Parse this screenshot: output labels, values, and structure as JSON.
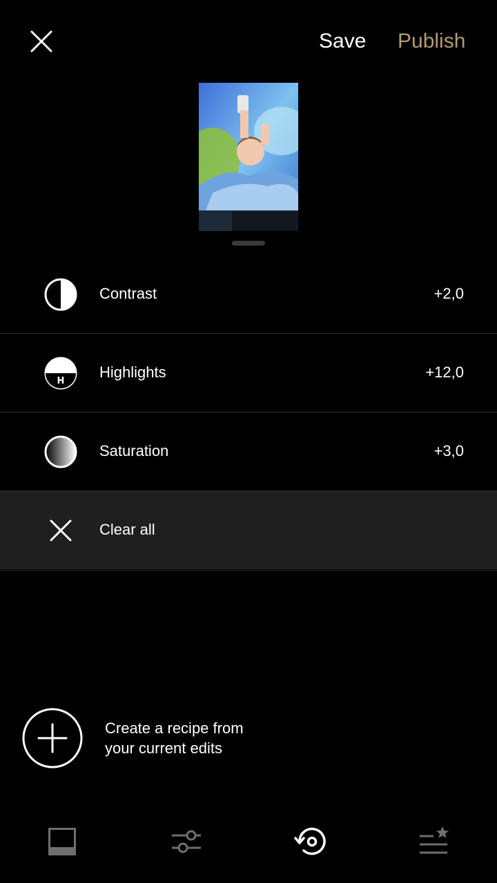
{
  "header": {
    "save_label": "Save",
    "publish_label": "Publish",
    "publish_color": "#b49a72",
    "close_icon": "close-icon"
  },
  "preview": {
    "handle": "drag-handle"
  },
  "edits": [
    {
      "label": "Contrast",
      "value": "+2,0",
      "icon": "contrast-icon"
    },
    {
      "label": "Highlights",
      "value": "+12,0",
      "icon": "highlights-icon"
    },
    {
      "label": "Saturation",
      "value": "+3,0",
      "icon": "saturation-icon"
    }
  ],
  "clear_all": {
    "label": "Clear all",
    "icon": "close-icon"
  },
  "recipe": {
    "line1": "Create a recipe from",
    "line2": "your current edits",
    "icon": "plus-icon"
  },
  "bottom_nav": [
    {
      "name": "presets",
      "icon": "preset-square-icon",
      "active": false
    },
    {
      "name": "tools",
      "icon": "sliders-icon",
      "active": false
    },
    {
      "name": "history",
      "icon": "history-icon",
      "active": true
    },
    {
      "name": "recipes",
      "icon": "recipes-list-icon",
      "active": false
    }
  ],
  "colors": {
    "background": "#000000",
    "row_highlight": "#1f1f1f",
    "inactive_icon": "#6e6e6e",
    "accent": "#b49a72"
  }
}
